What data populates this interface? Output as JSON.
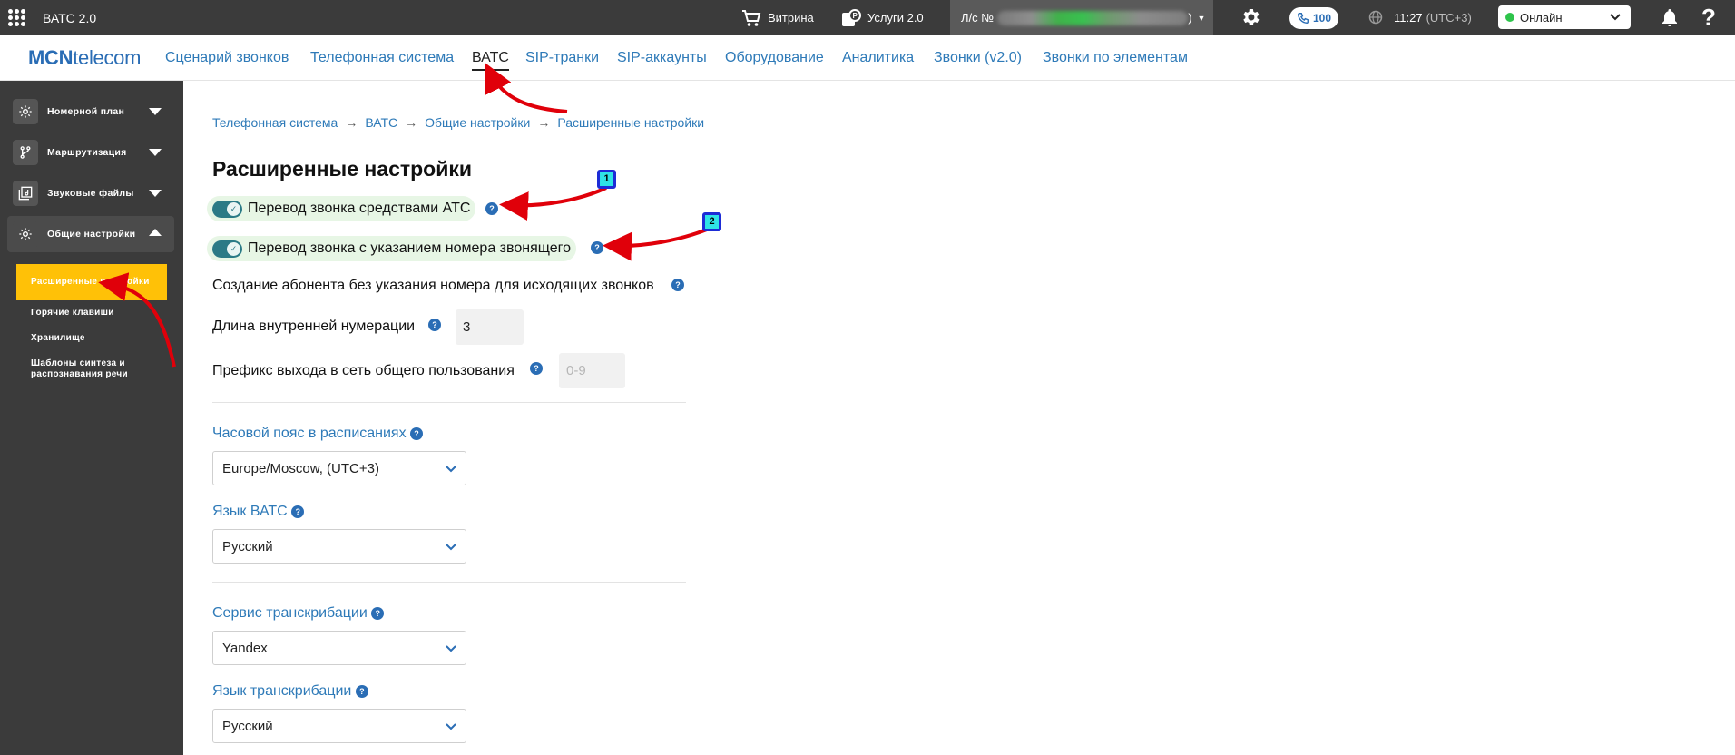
{
  "topbar": {
    "app_title": "ВАТС 2.0",
    "showcase": "Витрина",
    "services": "Услуги 2.0",
    "account_prefix": "Л/с №",
    "account_suffix": ")",
    "calls_count": "100",
    "time": "11:27",
    "timezone": "(UTC+3)",
    "status": "Онлайн",
    "status_color": "#2ec44b"
  },
  "logo": {
    "bold": "MCN",
    "rest": "telecom",
    "color": "#2a6db5"
  },
  "nav": [
    "Сценарий звонков",
    "Телефонная система",
    "ВАТС",
    "SIP-транки",
    "SIP-аккаунты",
    "Оборудование",
    "Аналитика",
    "Звонки (v2.0)",
    "Звонки по элементам"
  ],
  "sidebar": {
    "groups": [
      "Номерной план",
      "Маршрутизация",
      "Звуковые файлы",
      "Общие настройки"
    ],
    "subitems": [
      "Расширенные настройки",
      "Горячие клавиши",
      "Хранилище",
      "Шаблоны синтеза и распознавания речи"
    ]
  },
  "breadcrumb": [
    "Телефонная система",
    "ВАТС",
    "Общие настройки",
    "Расширенные настройки"
  ],
  "breadcrumb_sep": "→",
  "page_title": "Расширенные настройки",
  "help_glyph": "?",
  "toggles": [
    {
      "label": "Перевод звонка средствами АТС",
      "on": true
    },
    {
      "label": "Перевод звонка с указанием номера звонящего",
      "on": true
    }
  ],
  "settings": {
    "create_subscriber": "Создание абонента без указания номера для исходящих звонков",
    "internal_length_label": "Длина внутренней нумерации",
    "internal_length_value": "3",
    "prefix_label": "Префикс выхода в сеть общего пользования",
    "prefix_placeholder": "0-9"
  },
  "selects": [
    {
      "label": "Часовой пояс в расписаниях",
      "value": "Europe/Moscow, (UTC+3)"
    },
    {
      "label": "Язык ВАТС",
      "value": "Русский"
    },
    {
      "label": "Сервис транскрибации",
      "value": "Yandex"
    },
    {
      "label": "Язык транскрибации",
      "value": "Русский"
    }
  ],
  "annotations": [
    "1",
    "2"
  ]
}
